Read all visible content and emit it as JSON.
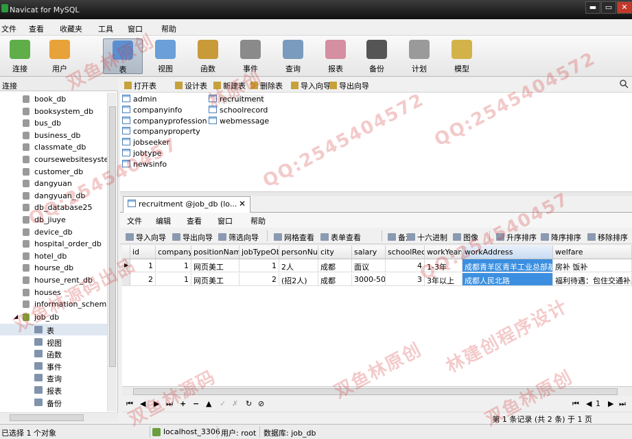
{
  "window": {
    "title": "Navicat for MySQL",
    "min": "▬",
    "max": "▭",
    "close": "✕"
  },
  "menu": [
    "文件",
    "查看",
    "收藏夹",
    "工具",
    "窗口",
    "帮助"
  ],
  "toolbar": [
    {
      "label": "连接",
      "icon": "connection-icon",
      "color": "#5fae4a"
    },
    {
      "label": "用户",
      "icon": "user-icon",
      "color": "#e8a23a"
    },
    {
      "label": "表",
      "icon": "table-icon",
      "color": "#5b8fd0",
      "active": true
    },
    {
      "label": "视图",
      "icon": "view-icon",
      "color": "#6a9fd8"
    },
    {
      "label": "函数",
      "icon": "function-icon",
      "color": "#c99a3a"
    },
    {
      "label": "事件",
      "icon": "event-icon",
      "color": "#8a8a8a"
    },
    {
      "label": "查询",
      "icon": "query-icon",
      "color": "#7a9bbd"
    },
    {
      "label": "报表",
      "icon": "report-icon",
      "color": "#d58fa0"
    },
    {
      "label": "备份",
      "icon": "backup-icon",
      "color": "#555555"
    },
    {
      "label": "计划",
      "icon": "schedule-icon",
      "color": "#9a9a9a"
    },
    {
      "label": "模型",
      "icon": "model-icon",
      "color": "#d4b24a"
    }
  ],
  "connections": {
    "header": "连接",
    "databases": [
      "book_db",
      "booksystem_db",
      "bus_db",
      "business_db",
      "classmate_db",
      "coursewebsitesyster",
      "customer_db",
      "dangyuan",
      "dangyuan_db",
      "db_database25",
      "db_jiuye",
      "device_db",
      "hospital_order_db",
      "hotel_db",
      "hourse_db",
      "hourse_rent_db",
      "houses",
      "information_schema"
    ],
    "open_db": "job_db",
    "children": [
      "表",
      "视图",
      "函数",
      "事件",
      "查询",
      "报表",
      "备份"
    ]
  },
  "object_toolbar": [
    "打开表",
    "设计表",
    "新建表",
    "删除表",
    "导入向导",
    "导出向导"
  ],
  "tables_col1": [
    "admin",
    "companyinfo",
    "companyprofession",
    "companyproperty",
    "jobseeker",
    "jobtype",
    "newsinfo"
  ],
  "tables_col2": [
    "recruitment",
    "schoolrecord",
    "webmessage"
  ],
  "tab": {
    "title": "recruitment @job_db (lo...",
    "close": "✕"
  },
  "inner_menu": [
    "文件",
    "编辑",
    "查看",
    "窗口",
    "帮助"
  ],
  "inner_toolbar": [
    "导入向导",
    "导出向导",
    "筛选向导",
    "网格查看",
    "表单查看",
    "备注",
    "十六进制",
    "图像",
    "升序排序",
    "降序排序",
    "移除排序"
  ],
  "grid": {
    "columns": [
      "id",
      "company",
      "positionNam",
      "jobTypeOb",
      "personNur",
      "city",
      "salary",
      "schoolRec",
      "workYears",
      "workAddress",
      "welfare"
    ],
    "rows": [
      [
        "1",
        "1",
        "网页美工",
        "1",
        "2人",
        "成都",
        "面议",
        "4",
        "1-3年",
        "成都青羊区青羊工业总部基",
        "房补 饭补"
      ],
      [
        "2",
        "1",
        "网页美工",
        "2",
        "(招2人)",
        "成都",
        "3000-500",
        "3",
        "3年以上",
        "成都人民北路",
        "福利待遇：包住交通补助"
      ]
    ]
  },
  "nav": {
    "first": "⏮",
    "prev": "◀",
    "next": "▶",
    "last": "⏭",
    "add": "+",
    "delete": "−",
    "up": "▲",
    "check": "✓",
    "cancel": "✗",
    "refresh": "↻",
    "stop": "⊘",
    "page": "1"
  },
  "record_info": "第 1 条记录 (共 2 条) 于 1 页",
  "status": {
    "selected": "已选择 1 个对象",
    "host": "localhost_3306",
    "user": "用户: root",
    "database": "数据库: job_db"
  },
  "watermarks": [
    "QQ:2545404572",
    "双鱼林原创",
    "双鱼林源码出品",
    "林建创程序设计",
    "QQ:254540457",
    "双鱼林原创",
    "QQ:2545404572",
    "双鱼林源码",
    "QQ:254540457",
    "林原创",
    "双鱼林原创"
  ]
}
